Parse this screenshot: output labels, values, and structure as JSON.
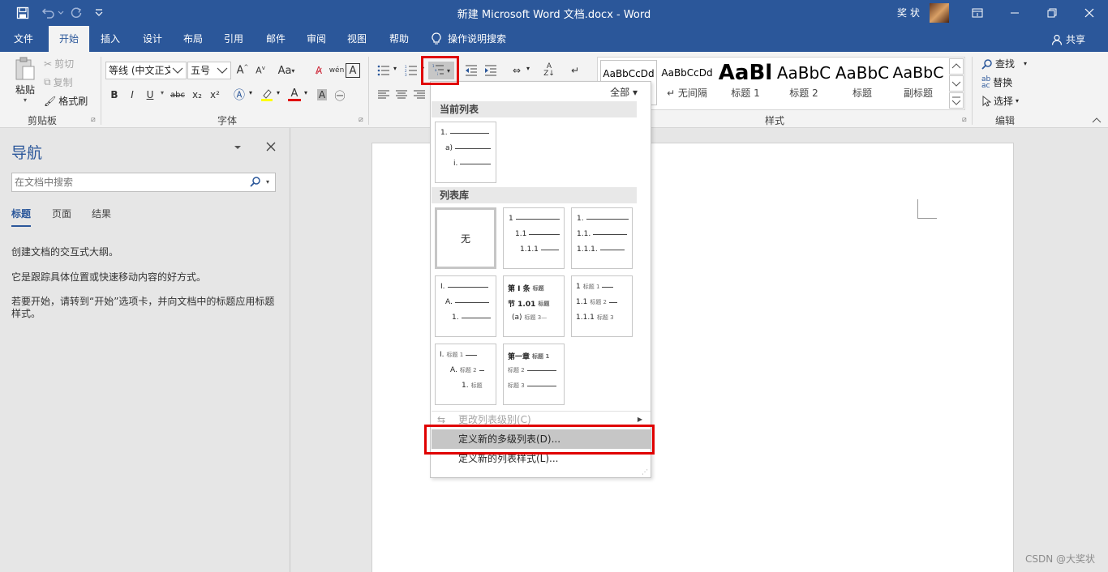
{
  "titlebar": {
    "title": "新建 Microsoft Word 文档.docx  -  Word",
    "user": "奖 状"
  },
  "tabs": [
    {
      "label": "文件"
    },
    {
      "label": "开始"
    },
    {
      "label": "插入"
    },
    {
      "label": "设计"
    },
    {
      "label": "布局"
    },
    {
      "label": "引用"
    },
    {
      "label": "邮件"
    },
    {
      "label": "审阅"
    },
    {
      "label": "视图"
    },
    {
      "label": "帮助"
    },
    {
      "label": "操作说明搜索"
    }
  ],
  "share_label": "共享",
  "ribbon": {
    "clipboard": {
      "paste": "粘贴",
      "cut": "剪切",
      "copy": "复制",
      "format_painter": "格式刷",
      "group": "剪贴板"
    },
    "font": {
      "font_name": "等线 (中文正文",
      "font_size": "五号",
      "group": "字体",
      "change_case": "Aa",
      "phonetic": "wén",
      "border_char": "A",
      "bold": "B",
      "italic": "I",
      "underline": "U",
      "strike": "abc",
      "sub": "x₂",
      "sup": "x²",
      "clear": "A",
      "char_shading": "A",
      "enclose": "字"
    },
    "styles": {
      "group": "样式",
      "items": [
        {
          "preview": "AaBbCcDd",
          "name": ""
        },
        {
          "preview": "AaBbCcDd",
          "name": "↵ 无间隔"
        },
        {
          "preview": "AaBl",
          "name": "标题 1"
        },
        {
          "preview": "AaBbC",
          "name": "标题 2"
        },
        {
          "preview": "AaBbC",
          "name": "标题"
        },
        {
          "preview": "AaBbC",
          "name": "副标题"
        }
      ]
    },
    "editing": {
      "find": "查找",
      "replace": "替换",
      "select": "选择",
      "group": "编辑"
    }
  },
  "nav": {
    "title": "导航",
    "search_placeholder": "在文档中搜索",
    "tabs": [
      "标题",
      "页面",
      "结果"
    ],
    "msg1": "创建文档的交互式大纲。",
    "msg2": "它是跟踪具体位置或快速移动内容的好方式。",
    "msg3": "若要开始，请转到“开始”选项卡，并向文档中的标题应用标题样式。"
  },
  "dropdown": {
    "filter": "全部",
    "current_list_header": "当前列表",
    "current_list": [
      "1.",
      "a)",
      "i."
    ],
    "library_header": "列表库",
    "none_label": "无",
    "lib2": [
      "1",
      "1.1",
      "1.1.1"
    ],
    "lib3": [
      "1.",
      "1.1.",
      "1.1.1."
    ],
    "lib4": [
      "I.",
      "A.",
      "1."
    ],
    "lib5": [
      {
        "num": "第 I 条",
        "sm": "标题"
      },
      {
        "num": "节 1.01",
        "sm": "标题"
      },
      {
        "num": "(a)",
        "sm": "标题 3—"
      }
    ],
    "lib6": [
      {
        "num": "1",
        "sm": "标题 1"
      },
      {
        "num": "1.1",
        "sm": "标题 2"
      },
      {
        "num": "1.1.1",
        "sm": "标题 3"
      }
    ],
    "lib7": [
      {
        "num": "I.",
        "sm": "标题 1"
      },
      {
        "num": "A.",
        "sm": "标题 2"
      },
      {
        "num": "1.",
        "sm": "标题"
      }
    ],
    "lib8": [
      {
        "num": "第一章",
        "sm": "标题 1"
      },
      {
        "num": "",
        "sm": "标题 2"
      },
      {
        "num": "",
        "sm": "标题 3"
      }
    ],
    "change_level": "更改列表级别(C)",
    "define_multilevel": "定义新的多级列表(D)...",
    "define_style": "定义新的列表样式(L)..."
  },
  "watermark": "CSDN @大奖状",
  "colors": {
    "accent": "#2b579a",
    "highlight": "#e00000"
  }
}
